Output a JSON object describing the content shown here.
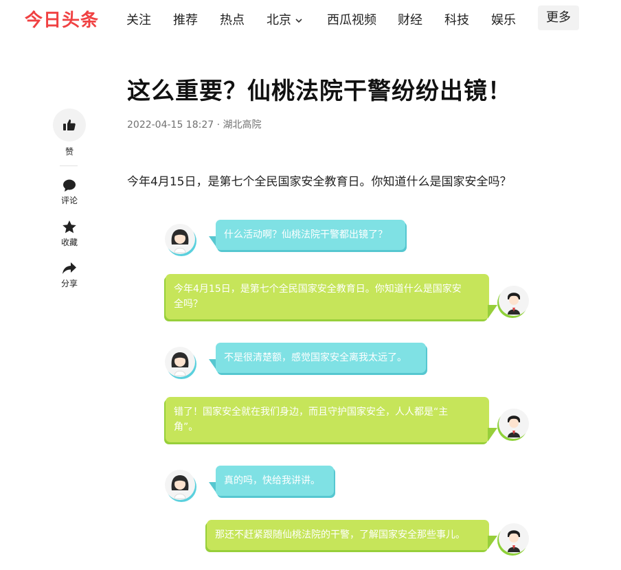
{
  "brand": {
    "logo": "今日头条",
    "accent": "#f04142"
  },
  "nav": {
    "items": [
      "关注",
      "推荐",
      "热点",
      "北京",
      "西瓜视频",
      "财经",
      "科技",
      "娱乐"
    ],
    "more": "更多"
  },
  "side_actions": {
    "like": "赞",
    "comment": "评论",
    "collect": "收藏",
    "share": "分享"
  },
  "article": {
    "title": "这么重要？仙桃法院干警纷纷出镜！",
    "meta": "2022-04-15 18:27 · 湖北高院",
    "lead": "今年4月15日，是第七个全民国家安全教育日。你知道什么是国家安全吗？"
  },
  "chat": [
    {
      "speaker": "girl",
      "text": "什么活动啊？仙桃法院干警都出镜了？"
    },
    {
      "speaker": "boy",
      "line1": "今年4月15日，是第七个全民国家安全教育日。你知道什么是国家安",
      "line2": "全吗？"
    },
    {
      "speaker": "girl",
      "text": "不是很清楚额，感觉国家安全离我太远了。"
    },
    {
      "speaker": "boy",
      "line1": "错了！国家安全就在我们身边，而且守护国家安全，人人都是“主",
      "line2": "角”。"
    },
    {
      "speaker": "girl",
      "text": "真的吗，快给我讲讲。"
    },
    {
      "speaker": "boy",
      "text": "那还不赶紧跟随仙桃法院的干警，了解国家安全那些事儿。"
    }
  ],
  "colors": {
    "girl_bubble": "#7fe1e4",
    "boy_bubble": "#c6e55a"
  }
}
